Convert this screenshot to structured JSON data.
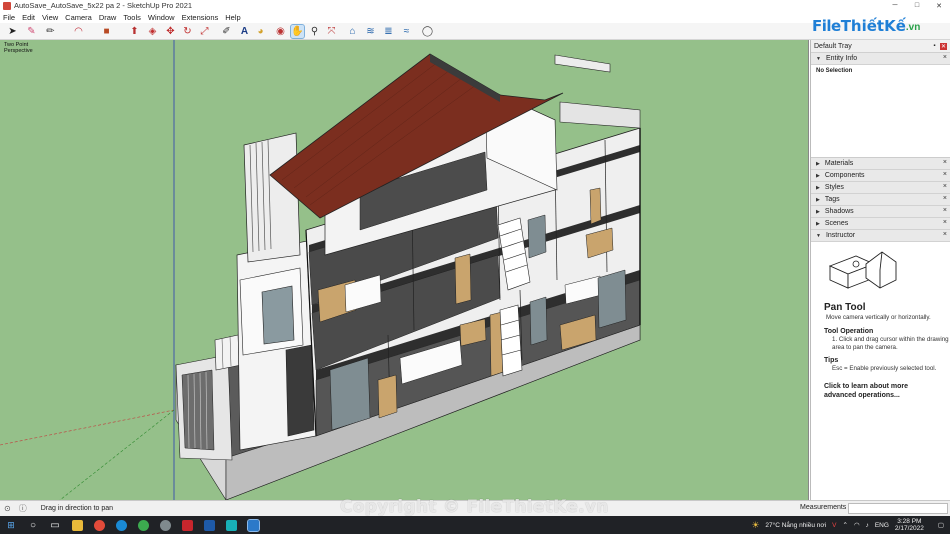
{
  "window": {
    "title": "AutoSave_AutoSave_5x22 pa 2 - SketchUp Pro 2021",
    "minimize": "─",
    "maximize": "□",
    "close": "✕"
  },
  "menu": [
    "File",
    "Edit",
    "View",
    "Camera",
    "Draw",
    "Tools",
    "Window",
    "Extensions",
    "Help"
  ],
  "toolbar": {
    "tools": [
      {
        "name": "select-tool-icon",
        "glyph": "➤"
      },
      {
        "name": "eraser-tool-icon",
        "glyph": "✎"
      },
      {
        "name": "line-tool-icon",
        "glyph": "✏"
      },
      {
        "name": "arc-tool-icon",
        "glyph": "◠"
      },
      {
        "name": "shape-tool-icon",
        "glyph": "■"
      },
      {
        "name": "push-pull-icon",
        "glyph": "⬆"
      },
      {
        "name": "offset-icon",
        "glyph": "◈"
      },
      {
        "name": "move-icon",
        "glyph": "✥"
      },
      {
        "name": "rotate-icon",
        "glyph": "↻"
      },
      {
        "name": "scale-icon",
        "glyph": "⤢"
      },
      {
        "name": "tape-measure-icon",
        "glyph": "✐"
      },
      {
        "name": "text-icon",
        "glyph": "A"
      },
      {
        "name": "paint-bucket-icon",
        "glyph": "◕"
      },
      {
        "name": "orbit-icon",
        "glyph": "◉"
      },
      {
        "name": "pan-icon",
        "glyph": "✋"
      },
      {
        "name": "zoom-icon",
        "glyph": "⚲"
      },
      {
        "name": "zoom-extents-icon",
        "glyph": "⤧"
      },
      {
        "name": "warehouse-icon",
        "glyph": "⌂"
      },
      {
        "name": "extension-warehouse-icon",
        "glyph": "≋"
      },
      {
        "name": "layout-icon",
        "glyph": "≣"
      },
      {
        "name": "styles-icon",
        "glyph": "≈"
      },
      {
        "name": "account-icon",
        "glyph": "◯"
      }
    ]
  },
  "brand": {
    "file": "File",
    "rest": "ThiếtKế",
    "vn": ".vn"
  },
  "viewport": {
    "camera_mode": "Two Point",
    "projection": "Perspective"
  },
  "tray": {
    "title": "Default Tray",
    "entity_info": {
      "label": "Entity Info",
      "selection": "No Selection"
    },
    "panels": [
      "Materials",
      "Components",
      "Styles",
      "Tags",
      "Shadows",
      "Scenes",
      "Instructor"
    ],
    "instructor": {
      "title": "Pan Tool",
      "subtitle": "Move camera vertically or horizontally.",
      "operation_heading": "Tool Operation",
      "operation_text": "1. Click and drag cursor within the drawing area to pan the camera.",
      "tips_heading": "Tips",
      "tips_text": "Esc = Enable previously selected tool.",
      "link": "Click to learn about more advanced operations..."
    }
  },
  "status": {
    "hint": "Drag in direction to pan",
    "measurements_label": "Measurements",
    "measurements_value": ""
  },
  "watermark": "Copyright © FileThietKe.vn",
  "taskbar": {
    "weather": "27°C  Nắng nhiều nơi",
    "language": "ENG",
    "time": "3:28 PM",
    "date": "2/17/2022"
  },
  "colors": {
    "viewport_bg": "#95c08a",
    "roof": "#7b2e1f",
    "floor": "#4a4a4a",
    "wall": "#f2f2f2",
    "wood": "#c9a46d"
  }
}
